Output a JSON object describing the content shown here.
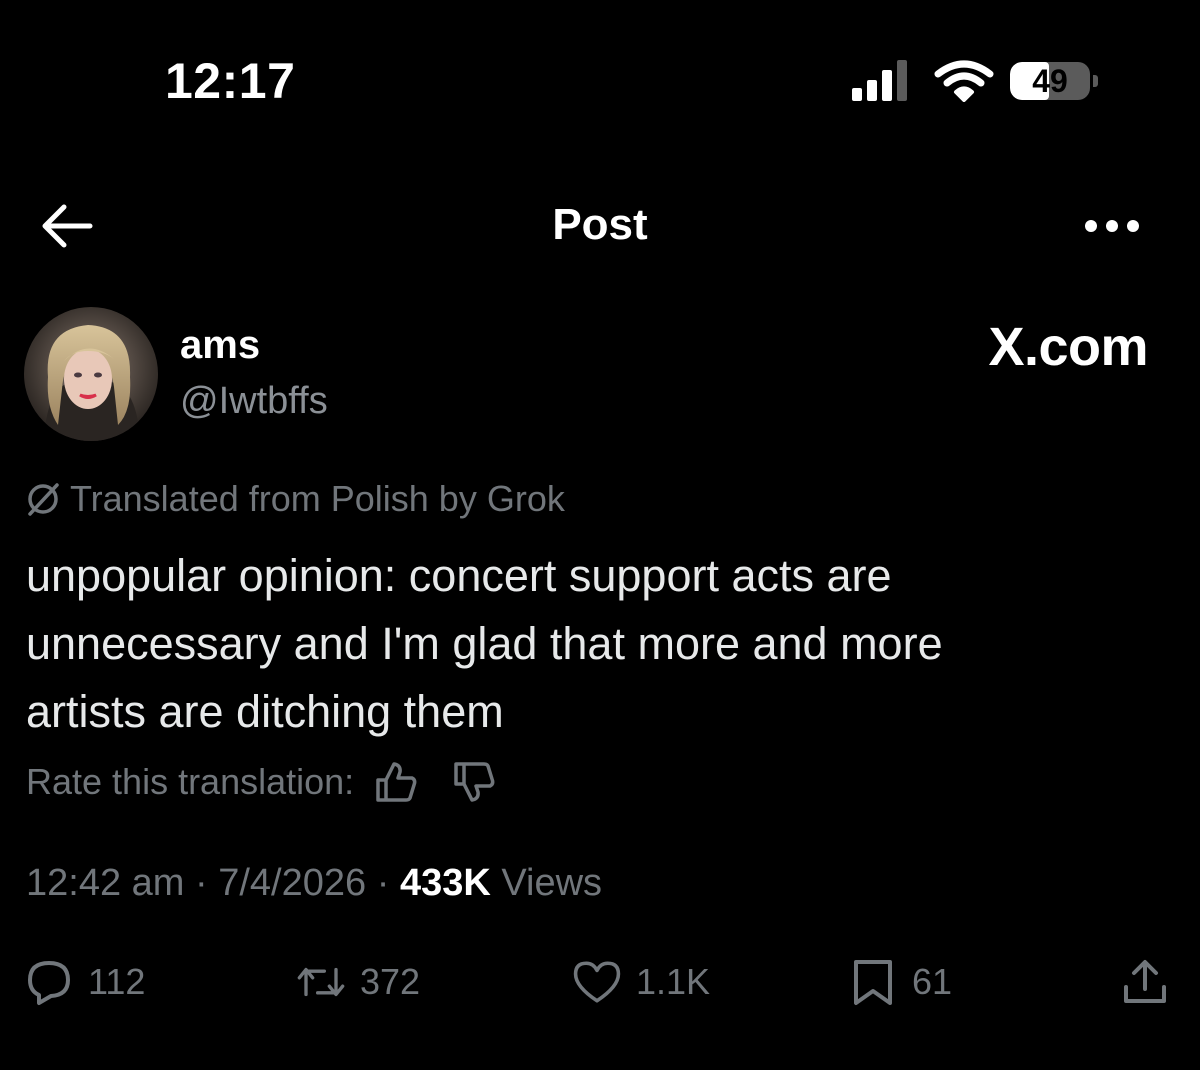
{
  "status_bar": {
    "time": "12:17",
    "battery_level": "49",
    "icons": [
      "cellular-signal-icon",
      "wifi-icon",
      "battery-icon"
    ]
  },
  "nav": {
    "title": "Post",
    "back_icon": "arrow-left-icon",
    "more_icon": "ellipsis-icon"
  },
  "author": {
    "display_name": "ams",
    "handle": "@Iwtbffs"
  },
  "watermark": "X.com",
  "translation": {
    "notice": "Translated from Polish by Grok",
    "notice_icon": "grok-icon"
  },
  "tweet": {
    "lines": [
      "unpopular opinion: concert support acts are",
      "unnecessary and I'm glad that more and more",
      "artists are ditching them"
    ]
  },
  "rate": {
    "label": "Rate this translation:",
    "icons": [
      "thumbs-up-icon",
      "thumbs-down-icon"
    ]
  },
  "meta": {
    "time": "12:42 am",
    "separator": "·",
    "date": "7/4/2026",
    "views_count": "433K",
    "views_label": "Views"
  },
  "actions": {
    "replies": "112",
    "reposts": "372",
    "likes": "1.1K",
    "bookmarks": "61"
  },
  "colors": {
    "background": "#000000",
    "text_primary": "#e7e9ea",
    "text_secondary": "#71767b"
  }
}
